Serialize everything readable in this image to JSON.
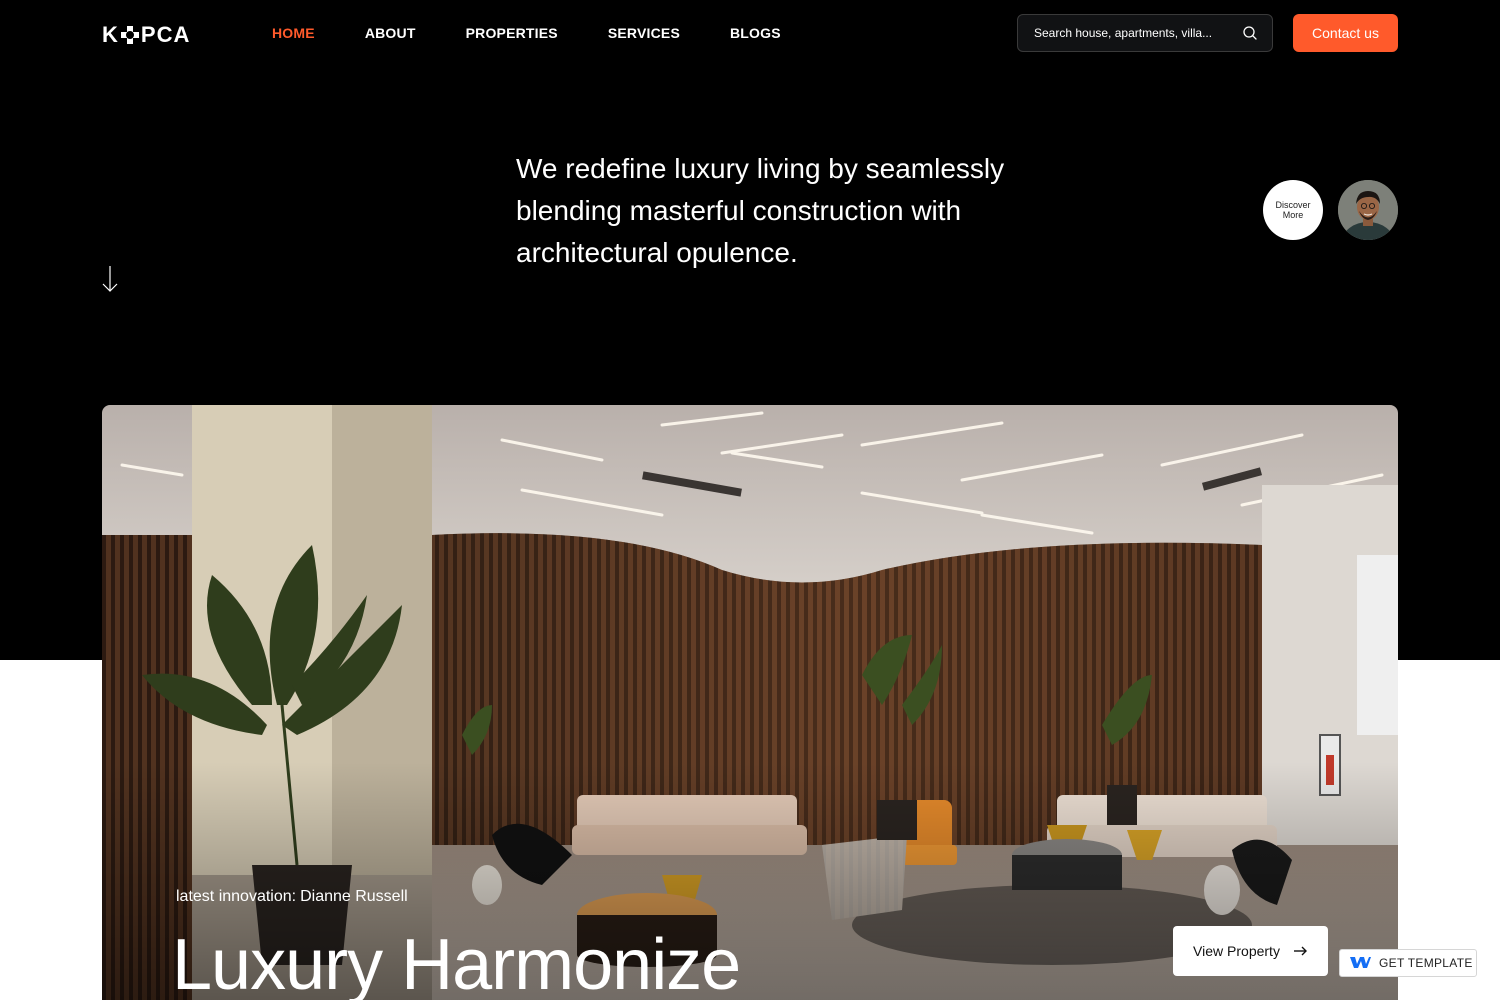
{
  "header": {
    "logo_text": "KOPCA",
    "nav": [
      {
        "label": "HOME",
        "active": true
      },
      {
        "label": "ABOUT",
        "active": false
      },
      {
        "label": "PROPERTIES",
        "active": false
      },
      {
        "label": "SERVICES",
        "active": false
      },
      {
        "label": "BLOGS",
        "active": false
      }
    ],
    "search_placeholder": "Search house, apartments, villa...",
    "contact_label": "Contact us"
  },
  "hero": {
    "tagline": "We redefine luxury living by seamlessly blending masterful construction with architectural opulence.",
    "discover_label": "Discover More"
  },
  "feature": {
    "innovation_prefix": "latest innovation:",
    "innovation_name": "Dianne Russell",
    "title": "Luxury Harmonize",
    "view_label": "View Property"
  },
  "badge": {
    "label": "GET TEMPLATE"
  },
  "colors": {
    "accent": "#ff5a2b",
    "background_dark": "#000000",
    "background_light": "#ffffff"
  },
  "icons": [
    "search-icon",
    "arrow-down-icon",
    "arrow-right-icon",
    "webflow-icon"
  ]
}
